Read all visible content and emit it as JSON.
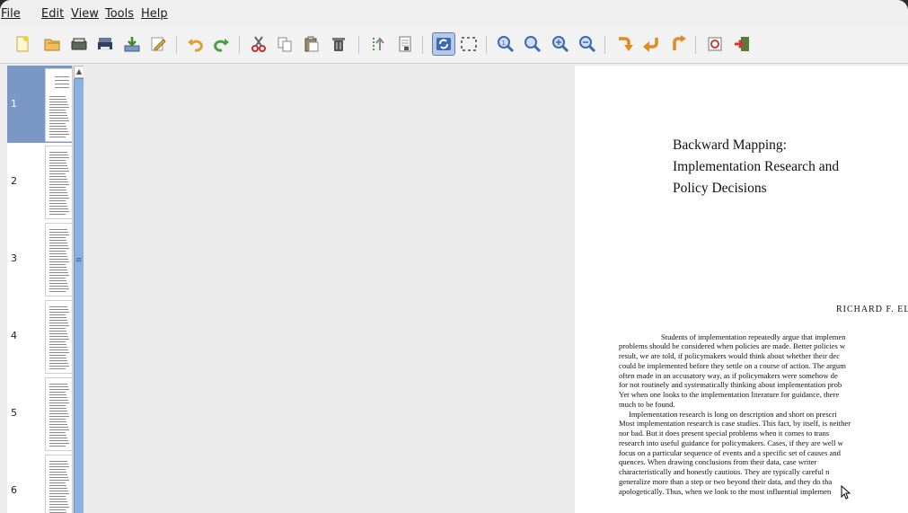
{
  "menu": [
    {
      "label": "File"
    },
    {
      "label": "Edit"
    },
    {
      "label": "View"
    },
    {
      "label": "Tools"
    },
    {
      "label": "Help"
    }
  ],
  "toolbar": {
    "buttons": [
      {
        "icon": "new-document-icon",
        "color": "#e8c23a"
      },
      {
        "icon": "open-folder-icon",
        "color": "#e0a53a"
      },
      {
        "icon": "scanner-icon",
        "color": "#4a5a4a"
      },
      {
        "icon": "printer-icon",
        "color": "#3a4a6a"
      },
      {
        "icon": "download-icon",
        "color": "#4c8a3c"
      },
      {
        "icon": "edit-icon",
        "color": "#c9a640"
      },
      {
        "icon": "undo-icon",
        "color": "#e0a030"
      },
      {
        "icon": "redo-icon",
        "color": "#4aa044"
      },
      {
        "icon": "cut-icon",
        "color": "#c23030"
      },
      {
        "icon": "copy-icon",
        "color": "#9a9a9a"
      },
      {
        "icon": "paste-icon",
        "color": "#7a6a4a"
      },
      {
        "icon": "delete-icon",
        "color": "#555555"
      },
      {
        "icon": "sort-icon",
        "color": "#4aa044"
      },
      {
        "icon": "page-properties-icon",
        "color": "#6a6a6a"
      },
      {
        "icon": "refresh-icon",
        "color": "#3a6ab0"
      },
      {
        "icon": "select-area-icon",
        "color": "#555555"
      },
      {
        "icon": "zoom-fit-icon",
        "color": "#3a6ab0"
      },
      {
        "icon": "zoom-width-icon",
        "color": "#3a6ab0"
      },
      {
        "icon": "zoom-in-icon",
        "color": "#3a6ab0"
      },
      {
        "icon": "zoom-out-icon",
        "color": "#3a6ab0"
      },
      {
        "icon": "rotate-down-icon",
        "color": "#e08a20"
      },
      {
        "icon": "rotate-left-icon",
        "color": "#e08a20"
      },
      {
        "icon": "rotate-right-icon",
        "color": "#e08a20"
      },
      {
        "icon": "page-settings-icon",
        "color": "#c83a3a"
      },
      {
        "icon": "exit-icon",
        "color": "#c83a3a"
      }
    ]
  },
  "thumbnails": [
    {
      "number": "1",
      "selected": true
    },
    {
      "number": "2",
      "selected": false
    },
    {
      "number": "3",
      "selected": false
    },
    {
      "number": "4",
      "selected": false
    },
    {
      "number": "5",
      "selected": false
    },
    {
      "number": "6",
      "selected": false
    }
  ],
  "document": {
    "title_lines": [
      "Backward Mapping:",
      "Implementation Research and",
      "Policy Decisions"
    ],
    "author": "RICHARD F. ELM",
    "body_lines": [
      "Students of implementation repeatedly argue that implemen",
      "problems should be considered when policies are made. Better policies w",
      "result, we are told, if policymakers would think about whether their dec",
      "could be implemented before they settle on a course of action. The argum",
      "often made in an accusatory way, as if policymakers were somehow de",
      "for not routinely and systematically thinking about implementation prob",
      "Yet when one looks to the implementation literature for guidance, there",
      "much to be found.",
      "Implementation research is long on description and short on prescri",
      "Most implementation research is case studies. This fact, by itself, is neither",
      "nor bad. But it does present special problems when it comes to trans",
      "research into useful guidance for policymakers. Cases, if they are well w",
      "focus on a particular sequence of events and a specific set of causes and",
      "quences. When drawing conclusions from their data, case writer",
      "characteristically and honestly cautious. They are typically careful n",
      "generalize more than a step or two beyond their data, and they do tha",
      "apologetically. Thus, when we look to the most influential implemen"
    ]
  }
}
